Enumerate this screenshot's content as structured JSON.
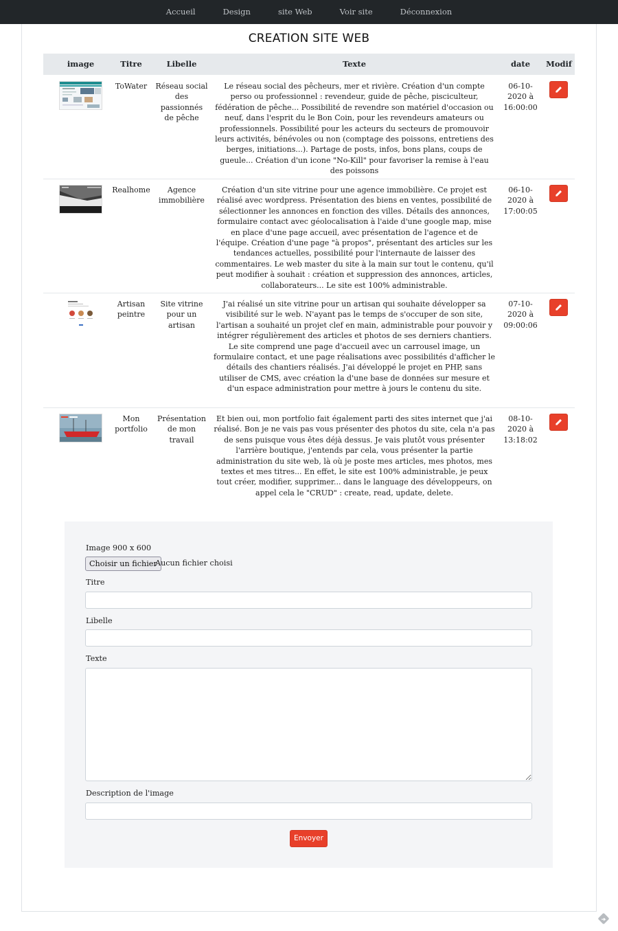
{
  "nav": {
    "items": [
      "Accueil",
      "Design",
      "site Web",
      "Voir site",
      "Déconnexion"
    ]
  },
  "page": {
    "title": "CREATION SITE WEB"
  },
  "table": {
    "headers": {
      "image": "image",
      "titre": "Titre",
      "libelle": "Libelle",
      "texte": "Texte",
      "date": "date",
      "modif": "Modif"
    },
    "rows": [
      {
        "titre": "ToWater",
        "libelle": "Réseau social des passionnés de pêche",
        "texte": "Le réseau social des pêcheurs, mer et rivière. Création d'un compte perso ou professionnel : revendeur, guide de pêche, pisciculteur, fédération de pêche... Possibilité de revendre son matériel d'occasion ou neuf, dans l'esprit du le Bon Coin, pour les revendeurs amateurs ou professionnels. Possibilité pour les acteurs du secteurs de promouvoir leurs activités, bénévoles ou non (comptage des poissons, entretiens des berges, initiations...). Partage de posts, infos, bons plans, coups de gueule... Création d'un icone \"No-Kill\" pour favoriser la remise à l'eau des poissons",
        "date": "06-10-2020 à 16:00:00"
      },
      {
        "titre": "Realhome",
        "libelle": "Agence immobilière",
        "texte": "Création d'un site vitrine pour une agence immobilière. Ce projet est réalisé avec wordpress. Présentation des biens en ventes, possibilité de sélectionner les annonces en fonction des villes. Détails des annonces, formulaire contact avec géolocalisation à l'aide d'une google map, mise en place d'une page accueil, avec présentation de l'agence et de l'équipe. Création d'une page \"à propos\", présentant des articles sur les tendances actuelles, possibilité pour l'internaute de laisser des commentaires. Le web master du site à la main sur tout le contenu, qu'il peut modifier à souhait : création et suppression des annonces, articles, collaborateurs... Le site est 100% administrable.",
        "date": "06-10-2020 à 17:00:05"
      },
      {
        "titre": "Artisan peintre",
        "libelle": "Site vitrine pour un artisan",
        "texte": "J'ai réalisé un site vitrine pour un artisan qui souhaite développer sa visibilité sur le web. N'ayant pas le temps de s'occuper de son site, l'artisan a souhaité un projet clef en main, administrable pour pouvoir y intégrer régulièrement des articles et photos de ses derniers chantiers. Le site comprend une page d'accueil avec un carrousel image, un formulaire contact, et une page réalisations avec possibilités d'afficher le détails des chantiers réalisés. J'ai développé le projet en PHP, sans utiliser de CMS, avec création la d'une base de données sur mesure et d'un espace administration pour mettre à jours le contenu du site.",
        "date": "07-10-2020 à 09:00:06"
      },
      {
        "titre": "Mon portfolio",
        "libelle": "Présentation de mon travail",
        "texte": "Et bien oui, mon portfolio fait également parti des sites internet que j'ai réalisé. Bon je ne vais pas vous présenter des photos du site, cela n'a pas de sens puisque vous êtes déjà dessus. Je vais plutôt vous présenter l'arrière boutique, j'entends par cela, vous présenter la partie administration du site web, là où je poste mes articles, mes photos, mes textes et mes titres... En effet, le site est 100% administrable, je peux tout créer, modifier, supprimer... dans le language des développeurs, on appel cela le \"CRUD\" : create, read, update, delete.",
        "date": "08-10-2020 à 13:18:02"
      }
    ]
  },
  "form": {
    "image_label": "Image 900 x 600",
    "file_button": "Choisir un fichier",
    "file_status": "Aucun fichier choisi",
    "titre_label": "Titre",
    "libelle_label": "Libelle",
    "texte_label": "Texte",
    "description_label": "Description de l'image",
    "submit_label": "Envoyer",
    "titre_value": "",
    "libelle_value": "",
    "description_value": ""
  },
  "colors": {
    "accent": "#e8402a",
    "nav_bg": "#222629",
    "header_bg": "#e6e9ec",
    "form_bg": "#f4f5f7"
  },
  "icons": {
    "edit": "pencil-icon",
    "corner": "diamond-arrow-icon"
  }
}
